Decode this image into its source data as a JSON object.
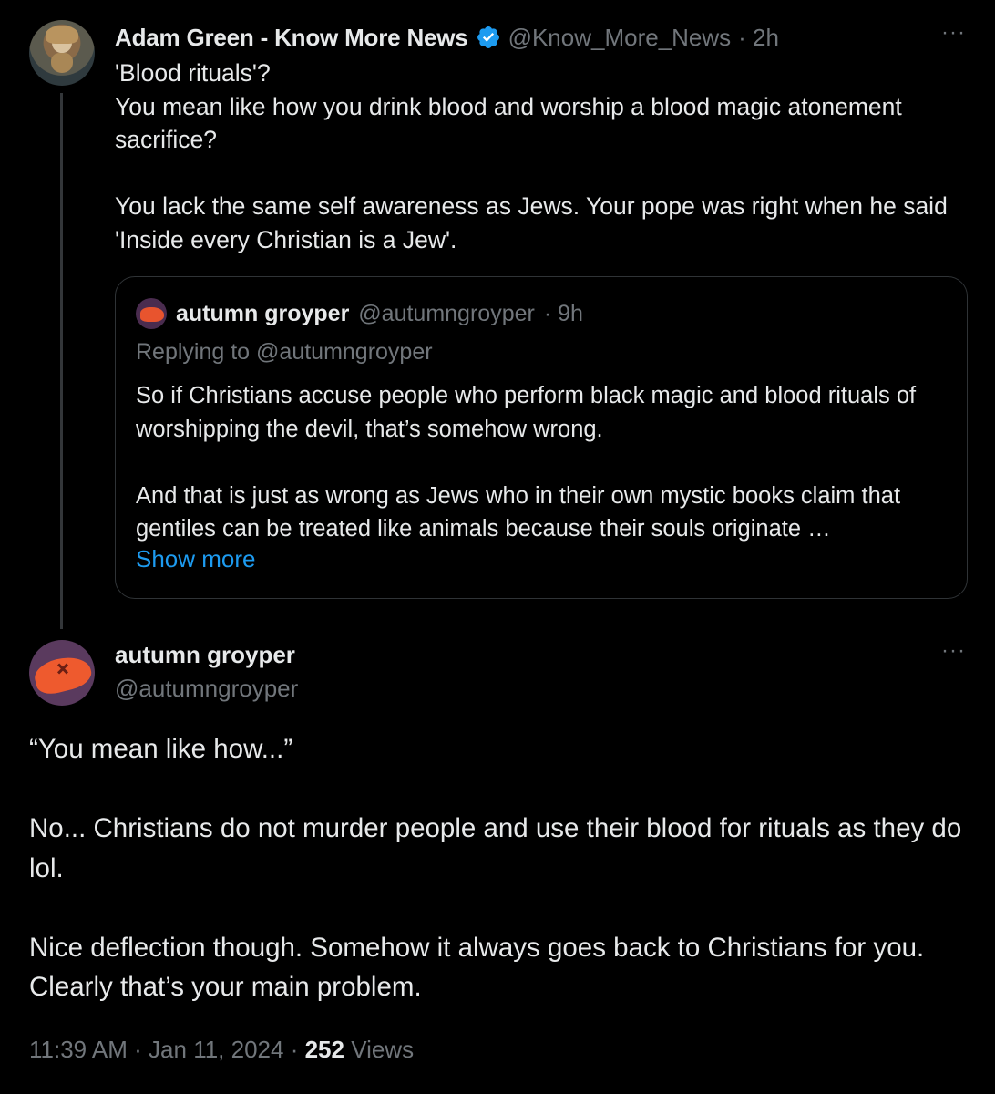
{
  "parent_tweet": {
    "author_name": "Adam Green - Know More News",
    "handle": "@Know_More_News",
    "time": "· 2h",
    "more": "···",
    "text": "'Blood rituals'?\nYou mean like how you drink blood and worship a blood magic atonement sacrifice?\n\nYou lack the same self awareness as Jews. Your pope was right when he said 'Inside every Christian is a Jew'."
  },
  "quoted_tweet": {
    "author_name": "autumn groyper",
    "handle": "@autumngroyper",
    "time": "· 9h",
    "replying_prefix": "Replying to ",
    "replying_to": "@autumngroyper",
    "text": "So if Christians accuse people who perform black magic and blood rituals of worshipping the devil, that’s somehow wrong.\n\nAnd that is just as wrong as Jews who in their own mystic books claim that gentiles can be treated like animals because their souls originate …",
    "show_more": "Show more"
  },
  "main_tweet": {
    "author_name": "autumn groyper",
    "handle": "@autumngroyper",
    "more": "···",
    "text": "“You mean like how...”\n\nNo... Christians do not murder people and use their blood for rituals as they do lol.\n\nNice deflection though. Somehow it always goes back to Christians for you. Clearly that’s your main problem.",
    "time": "11:39 AM",
    "date": "Jan 11, 2024",
    "views_count": "252",
    "views_label": "Views"
  },
  "colors": {
    "background": "#000000",
    "text": "#e7e9ea",
    "secondary": "#71767b",
    "link": "#1d9bf0",
    "verified": "#1d9bf0",
    "border": "#2f3336"
  },
  "icons": {
    "verified": "verified-badge-icon",
    "more": "more-options-icon"
  }
}
